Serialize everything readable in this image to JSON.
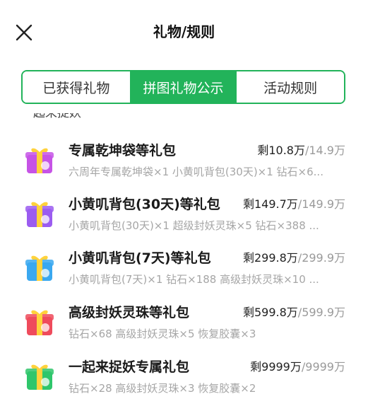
{
  "header": {
    "title": "礼物/规则"
  },
  "tabs": [
    {
      "label": "已获得礼物",
      "active": false
    },
    {
      "label": "拼图礼物公示",
      "active": true
    },
    {
      "label": "活动规则",
      "active": false
    }
  ],
  "section": {
    "partial_text": "一起来捉妖"
  },
  "colors": {
    "accent": "#22b35a",
    "text_primary": "#1a1a1a",
    "text_secondary": "#a6a6a6",
    "count_total": "#9a9a9a"
  },
  "gifts": [
    {
      "title": "专属乾坤袋等礼包",
      "remaining": "剩10.8万",
      "total": "/14.9万",
      "desc": "六周年专属乾坤袋×1 小黄叽背包(30天)×1 钻石×6...",
      "icon": "gift-box-purple-icon",
      "color": "#c653e6"
    },
    {
      "title": "小黄叽背包(30天)等礼包",
      "remaining": "剩149.7万",
      "total": "/149.9万",
      "desc": "小黄叽背包(30天)×1 超级封妖灵珠×5 钻石×388 ...",
      "icon": "gift-box-violet-icon",
      "color": "#9b5cf0"
    },
    {
      "title": "小黄叽背包(7天)等礼包",
      "remaining": "剩299.8万",
      "total": "/299.9万",
      "desc": "小黄叽背包(7天)×1 钻石×188 高级封妖灵珠×10 ...",
      "icon": "gift-box-blue-icon",
      "color": "#3aa8f0"
    },
    {
      "title": "高级封妖灵珠等礼包",
      "remaining": "剩599.8万",
      "total": "/599.9万",
      "desc": "钻石×68 高级封妖灵珠×5 恢复胶囊×3",
      "icon": "gift-box-red-icon",
      "color": "#ef4b5c"
    },
    {
      "title": "一起来捉妖专属礼包",
      "remaining": "剩9999万",
      "total": "/9999万",
      "desc": "钻石×28 高级封妖灵珠×3 恢复胶囊×2",
      "icon": "gift-box-green-icon",
      "color": "#2fc66b"
    }
  ]
}
